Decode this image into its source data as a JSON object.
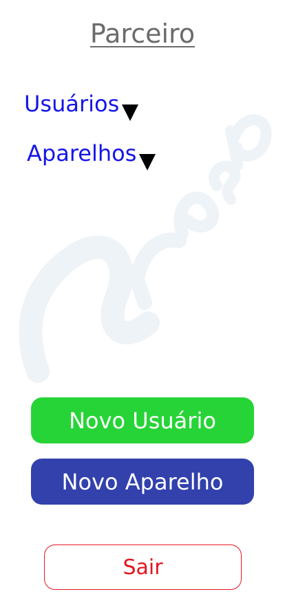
{
  "header": {
    "title": "Parceiro"
  },
  "menu": {
    "items": [
      {
        "label": "Usuários",
        "icon": "caret-down-icon"
      },
      {
        "label": "Aparelhos",
        "icon": "caret-down-icon"
      }
    ]
  },
  "actions": {
    "new_user_label": "Novo Usuário",
    "new_device_label": "Novo Aparelho",
    "exit_label": "Sair"
  },
  "colors": {
    "title": "#6b6b6b",
    "menu_link": "#1515e8",
    "new_user_button": "#27d437",
    "new_device_button": "#3241ac",
    "exit_button_border": "#e3161f",
    "watermark": "#eef3f7"
  }
}
